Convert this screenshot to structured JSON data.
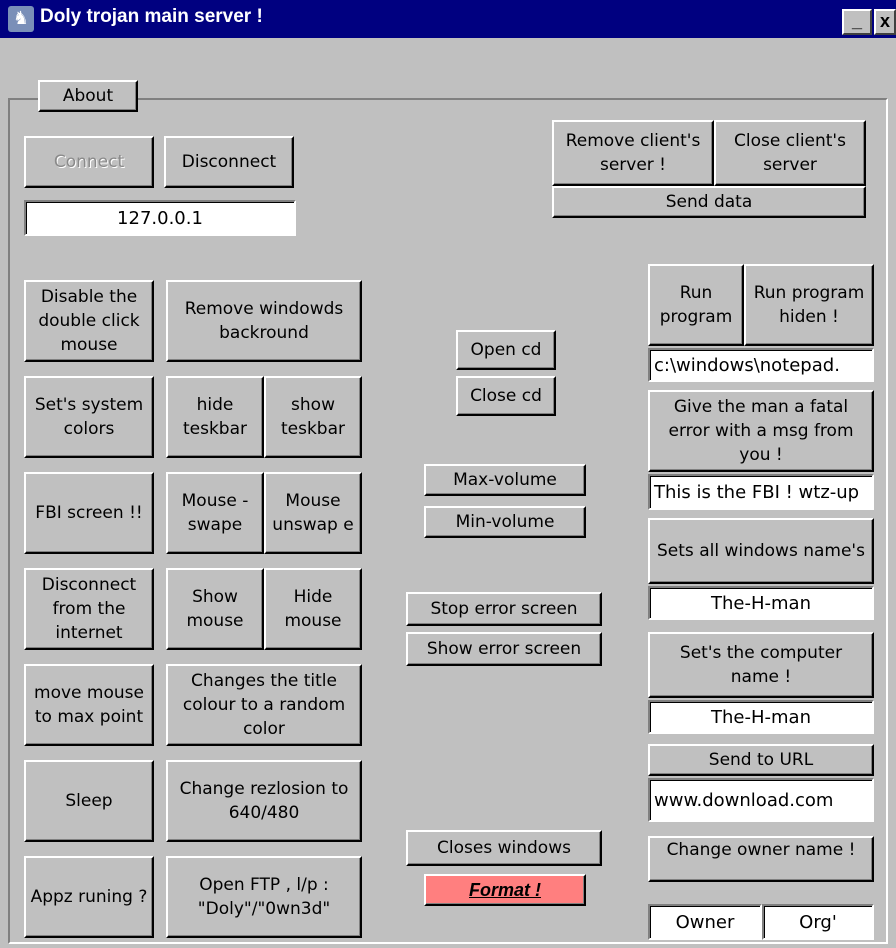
{
  "window": {
    "title": "Doly trojan main server !",
    "app_icon": "trojan-horse-icon",
    "minimize_label": "_",
    "close_label": "x"
  },
  "tab": {
    "about_label": "About"
  },
  "connection": {
    "connect_label": "Connect",
    "disconnect_label": "Disconnect",
    "ip_value": "127.0.0.1"
  },
  "client_server": {
    "remove_label": "Remove client's server !",
    "close_label": "Close client's server",
    "send_data_label": "Send data"
  },
  "left_actions": {
    "disable_double_click": "Disable the double click mouse",
    "remove_background": "Remove windowds backround",
    "set_system_colors": "Set's system colors",
    "hide_taskbar": "hide teskbar",
    "show_taskbar": "show teskbar",
    "fbi_screen": "FBI screen !!",
    "mouse_swap": "Mouse - swape",
    "mouse_unswap": "Mouse unswap e",
    "disconnect_internet": "Disconnect from the internet",
    "show_mouse": "Show mouse",
    "hide_mouse": "Hide mouse",
    "move_mouse_max": "move mouse to max point",
    "change_title_colour": "Changes the title colour to a random color",
    "sleep": "Sleep",
    "change_resolution": "Change rezlosion to 640/480",
    "apps_running": "Appz runing ?",
    "open_ftp": "Open FTP , l/p : \"Doly\"/\"0wn3d\""
  },
  "middle_actions": {
    "open_cd": "Open cd",
    "close_cd": "Close cd",
    "max_volume": "Max-volume",
    "min_volume": "Min-volume",
    "stop_error_screen": "Stop error screen",
    "show_error_screen": "Show error screen",
    "close_windows": "Closes windows",
    "format": "Format !"
  },
  "right_actions": {
    "run_program": "Run program",
    "run_program_hidden": "Run program hiden !",
    "program_path": "c:\\windows\\notepad.",
    "fatal_error": "Give the man a fatal error with a msg from you !",
    "fatal_error_msg": "This is the FBI ! wtz-up",
    "set_window_names": "Sets all windows name's",
    "window_name_value": "The-H-man",
    "set_computer_name": "Set's the computer name !",
    "computer_name_value": "The-H-man",
    "send_to_url": "Send to URL",
    "url_value": "www.download.com",
    "change_owner_name": "Change owner name !",
    "owner_value": "Owner",
    "org_value": "Org'"
  },
  "colors": {
    "titlebar": "#000080",
    "face": "#c0c0c0",
    "format_button": "#ff7f7f"
  }
}
